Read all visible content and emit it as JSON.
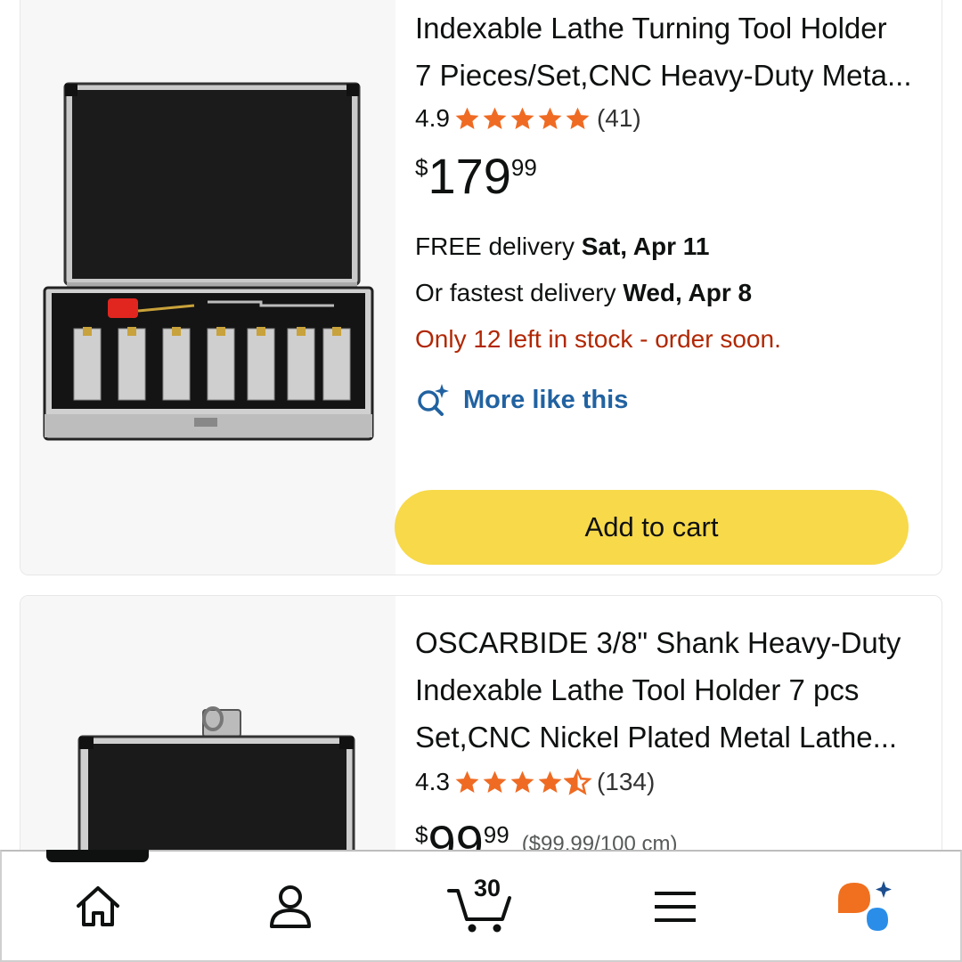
{
  "products": [
    {
      "title_line1": "Indexable Lathe Turning Tool Holder",
      "title_line2": "7 Pieces/Set,CNC Heavy-Duty Meta...",
      "rating": "4.9",
      "stars": 5,
      "review_count": "(41)",
      "price_symbol": "$",
      "price_whole": "179",
      "price_fraction": "99",
      "delivery_label": "FREE delivery ",
      "delivery_date": "Sat, Apr 11",
      "fastest_label": "Or fastest delivery ",
      "fastest_date": "Wed, Apr 8",
      "stock_text": "Only 12 left in stock - order soon.",
      "more_like_this": "More like this",
      "add_to_cart": "Add to cart"
    },
    {
      "title_line1": "OSCARBIDE 3/8\" Shank Heavy-Duty",
      "title_line2": "Indexable Lathe Tool Holder 7 pcs",
      "title_line3": "Set,CNC Nickel Plated Metal Lathe...",
      "rating": "4.3",
      "stars": 4.5,
      "review_count": "(134)",
      "price_symbol": "$",
      "price_whole": "99",
      "price_fraction": "99",
      "unit_price": "($99.99/100 cm)"
    }
  ],
  "tabbar": {
    "active_tab": "home",
    "cart_count": "30",
    "tabs": [
      "home-icon",
      "account-icon",
      "cart-icon",
      "menu-icon",
      "rufus-ai-icon"
    ]
  },
  "colors": {
    "star": "#ef6b23",
    "link": "#2162a1",
    "stock": "#b12704",
    "cart_button": "#f7d94a",
    "ai_orange": "#f0701f",
    "ai_blue": "#2a8ee8"
  }
}
